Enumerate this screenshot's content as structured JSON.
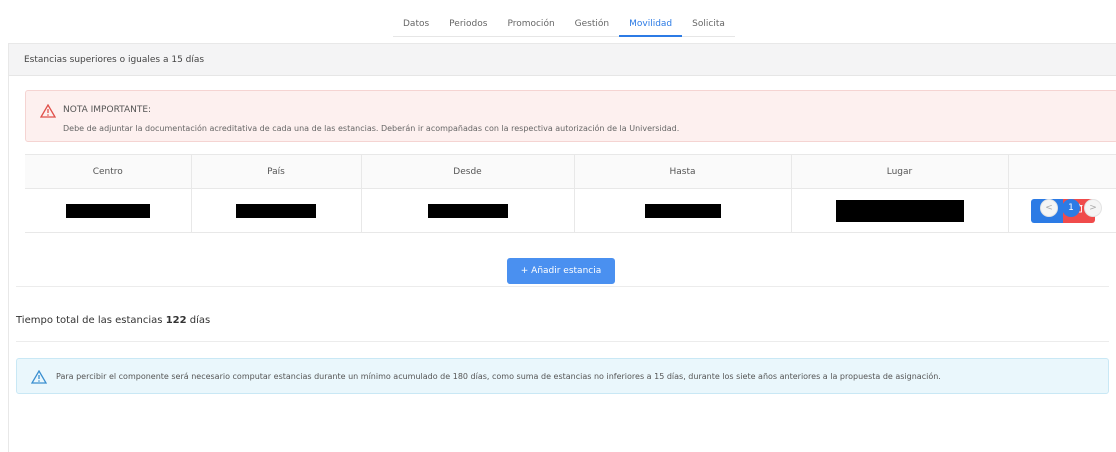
{
  "tabs": [
    {
      "label": "Datos"
    },
    {
      "label": "Periodos"
    },
    {
      "label": "Promoción"
    },
    {
      "label": "Gestión"
    },
    {
      "label": "Movilidad"
    },
    {
      "label": "Solicita"
    }
  ],
  "active_tab": "Movilidad",
  "section": {
    "title": "Estancias superiores o iguales a 15 días"
  },
  "notice": {
    "title": "NOTA IMPORTANTE:",
    "body": "Debe de adjuntar la documentación acreditativa de cada una de las estancias. Deberán ir acompañadas con la respectiva autorización de la Universidad."
  },
  "table": {
    "columns": [
      "Centro",
      "País",
      "Desde",
      "Hasta",
      "Lugar"
    ],
    "rows": [
      {
        "centro": "",
        "pais": "",
        "desde": "",
        "hasta": "",
        "lugar": ""
      }
    ]
  },
  "pagination": {
    "prev": "<",
    "current": "1",
    "next": ">"
  },
  "add_button": {
    "icon": "+",
    "label": "Añadir estancia"
  },
  "total": {
    "prefix": "Tiempo total de las estancias",
    "value": "122",
    "suffix": "días"
  },
  "info": {
    "text": "Para percibir el componente será necesario computar estancias durante un mínimo acumulado de 180 días, como suma de estancias no inferiores a 15 días, durante los siete años anteriores a la propuesta de asignación."
  },
  "colors": {
    "primary": "#2c7be5",
    "danger": "#f04b4b",
    "alert_bg": "#fdf0ef",
    "info_bg": "#eaf7fc"
  }
}
